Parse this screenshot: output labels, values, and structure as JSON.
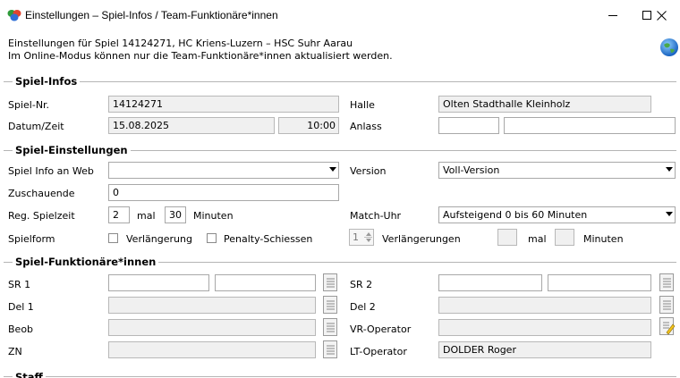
{
  "window": {
    "title": "Einstellungen – Spiel-Infos / Team-Funktionäre*innen"
  },
  "info": {
    "line1": "Einstellungen für Spiel 14124271, HC Kriens-Luzern – HSC Suhr Aarau",
    "line2": "Im Online-Modus können nur die Team-Funktionäre*innen aktualisiert werden."
  },
  "spiel_infos": {
    "legend": "Spiel-Infos",
    "spielnr_label": "Spiel-Nr.",
    "spielnr_value": "14124271",
    "halle_label": "Halle",
    "halle_value": "Olten Stadthalle Kleinholz",
    "datum_label": "Datum/Zeit",
    "datum_value": "15.08.2025",
    "zeit_value": "10:00",
    "anlass_label": "Anlass",
    "anlass_value1": "",
    "anlass_value2": ""
  },
  "spiel_einstellungen": {
    "legend": "Spiel-Einstellungen",
    "web_label": "Spiel Info an Web",
    "web_value": "",
    "version_label": "Version",
    "version_value": "Voll-Version",
    "zuschauende_label": "Zuschauende",
    "zuschauende_value": "0",
    "spielzeit_label": "Reg. Spielzeit",
    "spielzeit_count": "2",
    "mal_label": "mal",
    "spielzeit_minutes": "30",
    "minuten_label": "Minuten",
    "matchuhr_label": "Match-Uhr",
    "matchuhr_value": "Aufsteigend 0 bis 60 Minuten",
    "spielform_label": "Spielform",
    "verlaengerung_label": "Verlängerung",
    "penalty_label": "Penalty-Schiessen",
    "verl_count": "1",
    "verlaengerungen_label": "Verlängerungen",
    "verl_mal_value": "",
    "mal2_label": "mal",
    "verl_minutes_value": "",
    "minuten2_label": "Minuten"
  },
  "funktionaere": {
    "legend": "Spiel-Funktionäre*innen",
    "sr1_label": "SR 1",
    "sr2_label": "SR 2",
    "del1_label": "Del 1",
    "del2_label": "Del 2",
    "beob_label": "Beob",
    "vr_label": "VR-Operator",
    "zn_label": "ZN",
    "lt_label": "LT-Operator",
    "lt_value": "DOLDER Roger"
  },
  "staff": {
    "legend": "Staff"
  },
  "icons": {
    "app": "handball-app-icon",
    "globe": "globe-icon",
    "picker": "list-picker-icon",
    "picker_edit": "list-picker-edit-icon"
  },
  "colors": {
    "readonly_bg": "#f0f0f0",
    "border": "#a8a8a8",
    "section_line": "#b5b5b5"
  }
}
